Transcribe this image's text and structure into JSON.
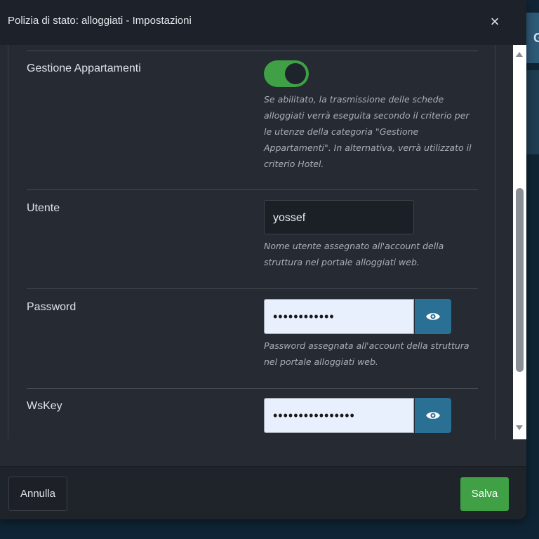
{
  "background": {
    "partial_label": "G"
  },
  "modal": {
    "title": "Polizia di stato: alloggiati - Impostazioni",
    "close_glyph": "×"
  },
  "fields": {
    "gestione": {
      "label": "Gestione Appartamenti",
      "enabled": true,
      "help_lines": [
        "Se abilitato, la trasmissione delle schede",
        "alloggiati verrà eseguita secondo il criterio per",
        "le utenze della categoria \"Gestione",
        "Appartamenti\". In alternativa, verrà utilizzato il",
        "criterio Hotel."
      ]
    },
    "utente": {
      "label": "Utente",
      "value": "yossef",
      "help_lines": [
        "Nome utente assegnato all'account della",
        "struttura nel portale alloggiati web."
      ]
    },
    "password": {
      "label": "Password",
      "masked_value": "••••••••••••",
      "toggle_icon": "eye-icon",
      "help_lines": [
        "Password assegnata all'account della struttura",
        "nel portale alloggiati web."
      ]
    },
    "wskey": {
      "label": "WsKey",
      "masked_value": "••••••••••••••••",
      "toggle_icon": "eye-icon"
    }
  },
  "footer": {
    "cancel_label": "Annulla",
    "save_label": "Salva"
  },
  "colors": {
    "accent_green": "#3fa046",
    "eye_button_blue": "#2a6f94",
    "modal_bg": "#262a33"
  }
}
